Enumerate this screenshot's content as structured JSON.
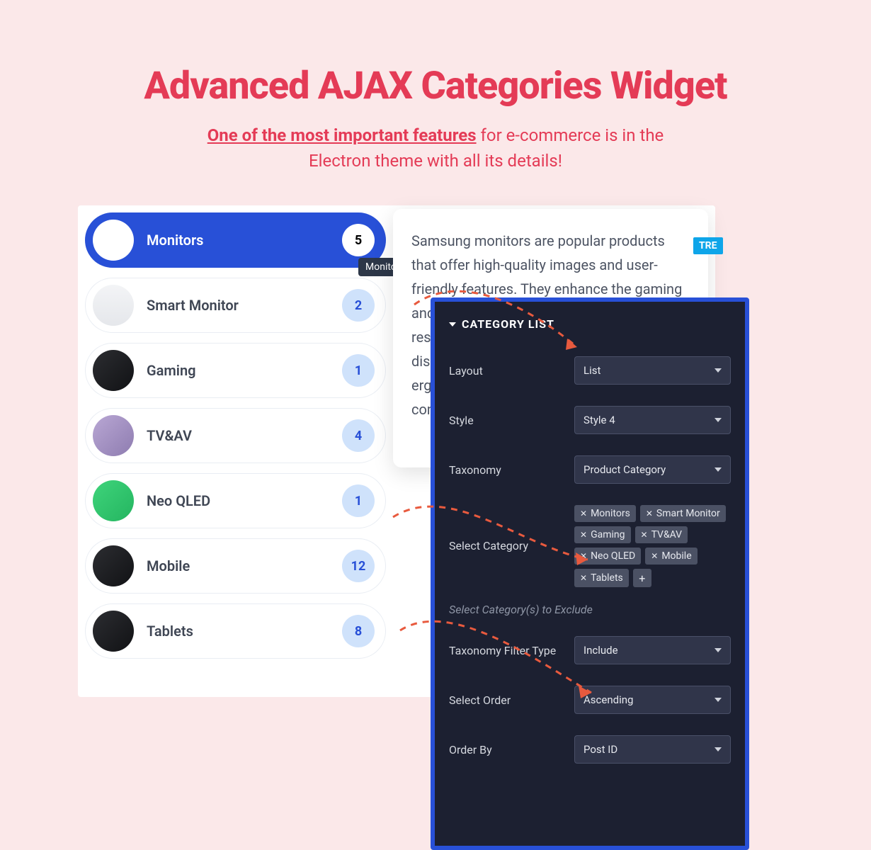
{
  "hero": {
    "title": "Advanced AJAX Categories Widget",
    "sub_strong": "One of the most important features",
    "sub_rest1": " for e-commerce is in the",
    "sub_rest2": "Electron theme with all its details!"
  },
  "categories": [
    {
      "label": "Monitors",
      "count": "5",
      "active": true
    },
    {
      "label": "Smart Monitor",
      "count": "2",
      "active": false
    },
    {
      "label": "Gaming",
      "count": "1",
      "active": false
    },
    {
      "label": "TV&AV",
      "count": "4",
      "active": false
    },
    {
      "label": "Neo QLED",
      "count": "1",
      "active": false
    },
    {
      "label": "Mobile",
      "count": "12",
      "active": false
    },
    {
      "label": "Tablets",
      "count": "8",
      "active": false
    }
  ],
  "tooltip": "Monitors",
  "description": "Samsung monitors are popular products that offer high-quality images and user-friendly features. They enhance the gaming and watching experience by providing high resolutions, vibrant colors and advanced display technologies. In addition, they offer ergonomic designs that increase work comfort.",
  "tre_badge": "TRE",
  "settings": {
    "header": "CATEGORY LIST",
    "layout": {
      "label": "Layout",
      "value": "List"
    },
    "style": {
      "label": "Style",
      "value": "Style 4"
    },
    "taxonomy": {
      "label": "Taxonomy",
      "value": "Product Category"
    },
    "select_cat": {
      "label": "Select Category"
    },
    "tags": [
      "Monitors",
      "Smart Monitor",
      "Gaming",
      "TV&AV",
      "Neo QLED",
      "Mobile",
      "Tablets"
    ],
    "exclude_hint": "Select Category(s) to Exclude",
    "filter_type": {
      "label": "Taxonomy Filter Type",
      "value": "Include"
    },
    "order": {
      "label": "Select Order",
      "value": "Ascending"
    },
    "order_by": {
      "label": "Order By",
      "value": "Post ID"
    }
  }
}
